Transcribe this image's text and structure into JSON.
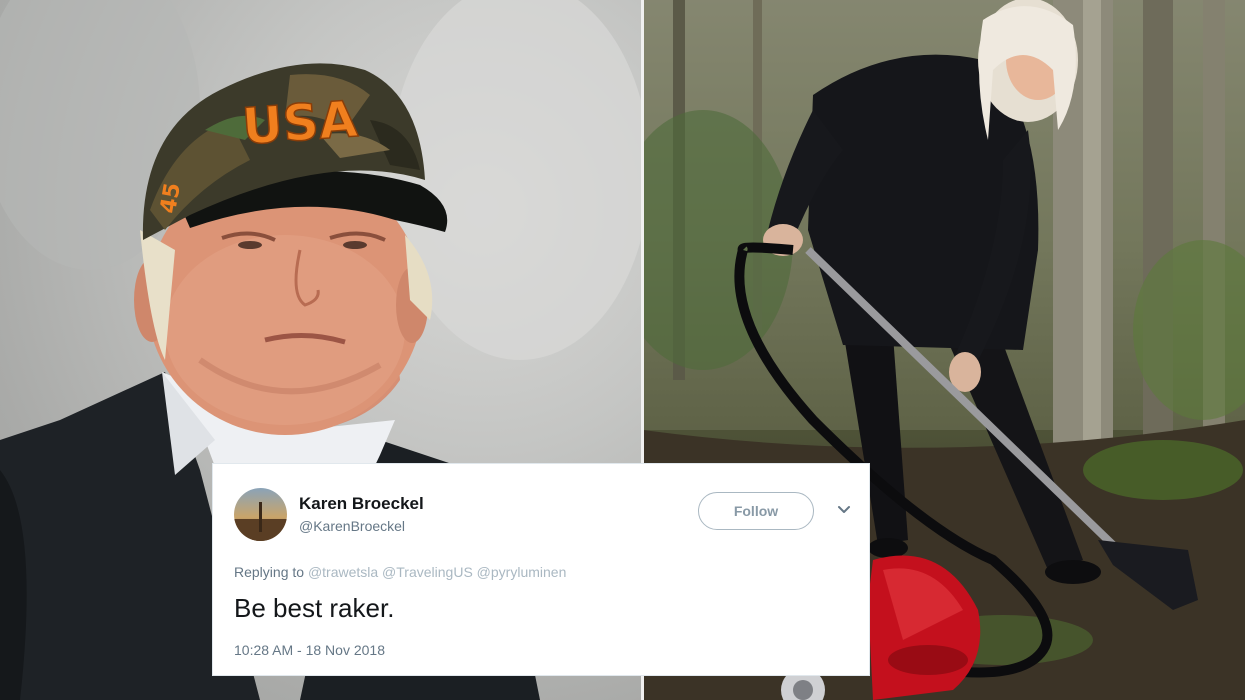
{
  "left_photo": {
    "cap_text": "USA",
    "cap_number": "45"
  },
  "tweet": {
    "display_name": "Karen Broeckel",
    "handle": "@KarenBroeckel",
    "follow_label": "Follow",
    "replying_to_label": "Replying to",
    "replying_to_mentions": "@trawetsla @TravelingUS @pyryluminen",
    "text": "Be best raker.",
    "timestamp": "10:28 AM - 18 Nov 2018"
  },
  "colors": {
    "text_primary": "#14171a",
    "text_secondary": "#657786",
    "follow_border": "#aab8c2",
    "cap_embroidery": "#f07f1e"
  },
  "icons": {
    "menu": "chevron-down-icon",
    "avatar": "avatar"
  }
}
